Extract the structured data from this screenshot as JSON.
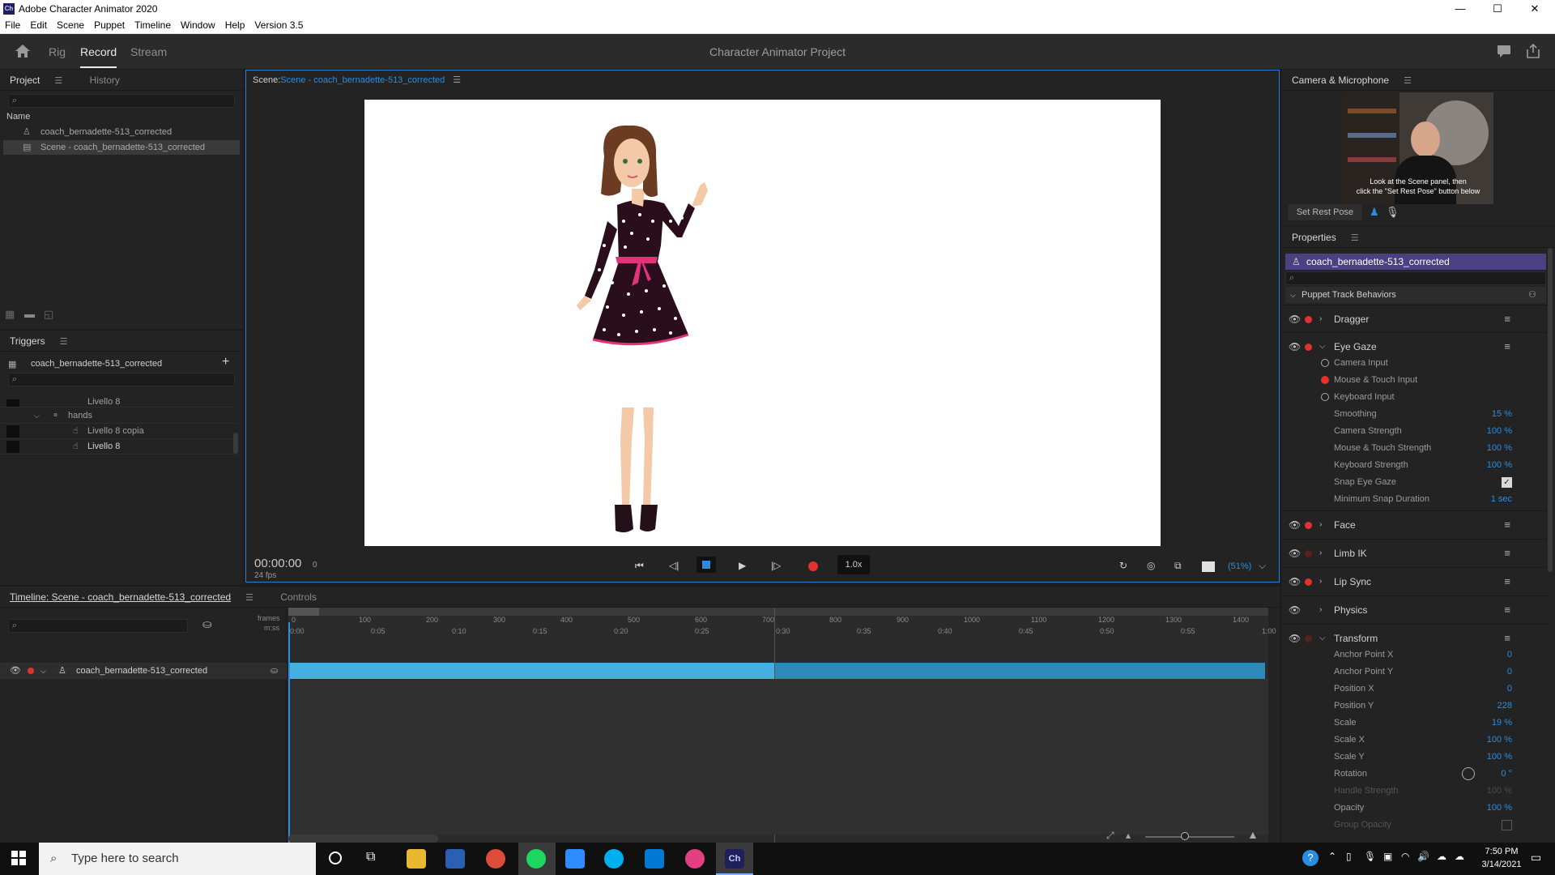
{
  "window": {
    "title": "Adobe Character Animator 2020",
    "logo_text": "Ch",
    "minimize": "—",
    "maximize": "☐",
    "close": "✕"
  },
  "menu": [
    "File",
    "Edit",
    "Scene",
    "Puppet",
    "Timeline",
    "Window",
    "Help",
    "Version 3.5"
  ],
  "nav": {
    "modes": [
      "Rig",
      "Record",
      "Stream"
    ],
    "active_mode": "Record",
    "project_title": "Character Animator Project"
  },
  "project_panel": {
    "tabs": [
      "Project",
      "History"
    ],
    "column": "Name",
    "items": [
      "coach_bernadette-513_corrected",
      "Scene - coach_bernadette-513_corrected"
    ]
  },
  "triggers_panel": {
    "title": "Triggers",
    "puppet": "coach_bernadette-513_corrected",
    "rows": [
      "Livello 8",
      "hands",
      "Livello 8 copia",
      "Livello 8"
    ]
  },
  "scene_panel": {
    "label": "Scene:",
    "scene_name": "Scene - coach_bernadette-513_corrected",
    "timecode": "00:00:00",
    "frame": "0",
    "fps": "24 fps",
    "speed": "1.0x",
    "zoom": "(51%)"
  },
  "camera_panel": {
    "title": "Camera & Microphone",
    "overlay_line1": "Look at the Scene panel, then",
    "overlay_line2": "click the \"Set Rest Pose\" button below",
    "set_rest_pose": "Set Rest Pose"
  },
  "properties_panel": {
    "title": "Properties",
    "puppet": "coach_bernadette-513_corrected",
    "section": "Puppet Track Behaviors",
    "behaviors_top": [
      "Dragger"
    ],
    "eye_gaze": {
      "name": "Eye Gaze",
      "inputs": [
        "Camera Input",
        "Mouse & Touch Input",
        "Keyboard Input"
      ],
      "params": [
        {
          "label": "Smoothing",
          "value": "15 %"
        },
        {
          "label": "Camera Strength",
          "value": "100 %"
        },
        {
          "label": "Mouse & Touch Strength",
          "value": "100 %"
        },
        {
          "label": "Keyboard Strength",
          "value": "100 %"
        },
        {
          "label": "Snap Eye Gaze",
          "value": ""
        },
        {
          "label": "Minimum Snap Duration",
          "value": "1 sec"
        }
      ]
    },
    "behaviors_mid": [
      "Face",
      "Limb IK",
      "Lip Sync",
      "Physics"
    ],
    "transform": {
      "name": "Transform",
      "params": [
        {
          "label": "Anchor Point X",
          "value": "0"
        },
        {
          "label": "Anchor Point Y",
          "value": "0"
        },
        {
          "label": "Position X",
          "value": "0"
        },
        {
          "label": "Position Y",
          "value": "228"
        },
        {
          "label": "Scale",
          "value": "19 %"
        },
        {
          "label": "Scale X",
          "value": "100 %"
        },
        {
          "label": "Scale Y",
          "value": "100 %"
        },
        {
          "label": "Rotation",
          "value": "0 °"
        },
        {
          "label": "Handle Strength",
          "value": "100 %"
        },
        {
          "label": "Opacity",
          "value": "100 %"
        },
        {
          "label": "Group Opacity",
          "value": ""
        }
      ]
    }
  },
  "timeline_panel": {
    "tabs": [
      "Timeline: Scene - coach_bernadette-513_corrected",
      "Controls"
    ],
    "frames_label": "frames",
    "mss_label": "m:ss",
    "frame_ticks": [
      "0",
      "100",
      "200",
      "300",
      "400",
      "500",
      "600",
      "700",
      "800",
      "900",
      "1000",
      "1100",
      "1200",
      "1300",
      "1400"
    ],
    "time_ticks": [
      "0:00",
      "0:05",
      "0:10",
      "0:15",
      "0:20",
      "0:25",
      "0:30",
      "0:35",
      "0:40",
      "0:45",
      "0:50",
      "0:55",
      "1:00"
    ],
    "track_name": "coach_bernadette-513_corrected"
  },
  "taskbar": {
    "search_placeholder": "Type here to search",
    "time": "7:50 PM",
    "date": "3/14/2021"
  }
}
